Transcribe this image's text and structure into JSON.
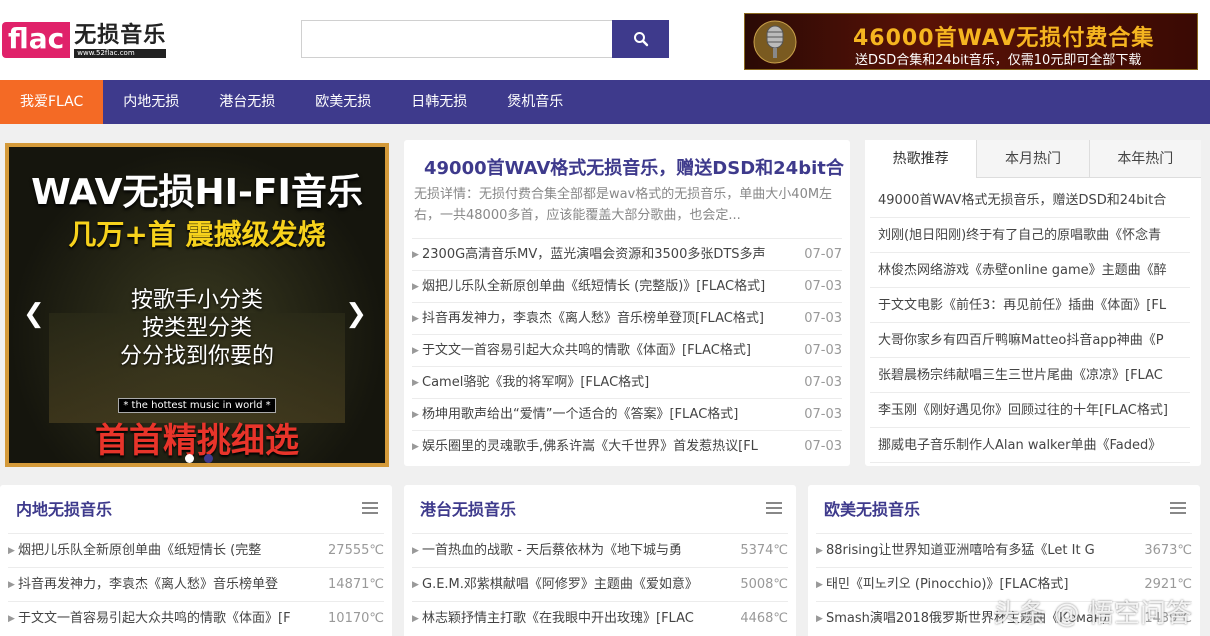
{
  "logo": {
    "brand": "flac",
    "name": "无损音乐",
    "url": "www.52flac.com"
  },
  "search": {
    "placeholder": ""
  },
  "ad": {
    "line1": "46000首WAV无损付费合集",
    "line2": "送DSD合集和24bit音乐，仅需10元即可全部下载"
  },
  "nav": [
    "我爱FLAC",
    "内地无损",
    "港台无损",
    "欧美无损",
    "日韩无损",
    "煲机音乐"
  ],
  "slider": {
    "title": "WAV无损HI-FI音乐",
    "subtitle": "几万+首  震撼级发烧",
    "lines": [
      "按歌手小分类",
      "按类型分类",
      "分分找到你要的"
    ],
    "tag": "* the hottest music in world *",
    "bottom": "首首精挑细选"
  },
  "featured": {
    "title": "49000首WAV格式无损音乐，赠送DSD和24bit合",
    "desc": "无损详情：无损付费合集全部都是wav格式的无损音乐，单曲大小40M左右，一共48000多首，应该能覆盖大部分歌曲，也会定...",
    "items": [
      {
        "text": "2300G高清音乐MV，蓝光演唱会资源和3500多张DTS多声",
        "date": "07-07"
      },
      {
        "text": "烟把儿乐队全新原创单曲《纸短情长 (完整版)》[FLAC格式]",
        "date": "07-03"
      },
      {
        "text": "抖音再发神力，李袁杰《离人愁》音乐榜单登顶[FLAC格式]",
        "date": "07-03"
      },
      {
        "text": "于文文一首容易引起大众共鸣的情歌《体面》[FLAC格式]",
        "date": "07-03"
      },
      {
        "text": "Camel骆驼《我的将军啊》[FLAC格式]",
        "date": "07-03"
      },
      {
        "text": "杨坤用歌声给出“爱情”一个适合的《答案》[FLAC格式]",
        "date": "07-03"
      },
      {
        "text": "娱乐圈里的灵魂歌手,佛系许嵩《大千世界》首发惹热议[FL",
        "date": "07-03"
      }
    ]
  },
  "hot": {
    "tabs": [
      "热歌推荐",
      "本月热门",
      "本年热门"
    ],
    "items": [
      "49000首WAV格式无损音乐，赠送DSD和24bit合",
      "刘刚(旭日阳刚)终于有了自己的原唱歌曲《怀念青",
      "林俊杰网络游戏《赤壁online game》主题曲《醉",
      "于文文电影《前任3：再见前任》插曲《体面》[FL",
      "大哥你家乡有四百斤鸭嘛Matteo抖音app神曲《P",
      "张碧晨杨宗纬献唱三生三世片尾曲《凉凉》[FLAC",
      "李玉刚《刚好遇见你》回顾过往的十年[FLAC格式]",
      "挪威电子音乐制作人Alan walker单曲《Faded》"
    ]
  },
  "panels": [
    {
      "title": "内地无损音乐",
      "items": [
        {
          "text": "烟把儿乐队全新原创单曲《纸短情长 (完整",
          "meta": "27555℃"
        },
        {
          "text": "抖音再发神力，李袁杰《离人愁》音乐榜单登",
          "meta": "14871℃"
        },
        {
          "text": "于文文一首容易引起大众共鸣的情歌《体面》[F",
          "meta": "10170℃"
        }
      ]
    },
    {
      "title": "港台无损音乐",
      "items": [
        {
          "text": "一首热血的战歌 - 天后蔡依林为《地下城与勇",
          "meta": "5374℃"
        },
        {
          "text": "G.E.M.邓紫棋献唱《阿修罗》主题曲《爱如意》",
          "meta": "5008℃"
        },
        {
          "text": "林志颖抒情主打歌《在我眼中开出玫瑰》[FLAC",
          "meta": "4468℃"
        }
      ]
    },
    {
      "title": "欧美无损音乐",
      "items": [
        {
          "text": "88rising让世界知道亚洲嘻哈有多猛《Let It G",
          "meta": "3673℃"
        },
        {
          "text": "태민《피노키오 (Pinocchio)》[FLAC格式]",
          "meta": "2921℃"
        },
        {
          "text": "Smash演唱2018俄罗斯世界杯主题曲《Команд",
          "meta": "1439℃"
        }
      ]
    }
  ],
  "watermark": "头条 @ 悟空问答",
  "colors": {
    "primary": "#3e3a8c",
    "accent": "#f46a25",
    "logo": "#e0226a"
  }
}
